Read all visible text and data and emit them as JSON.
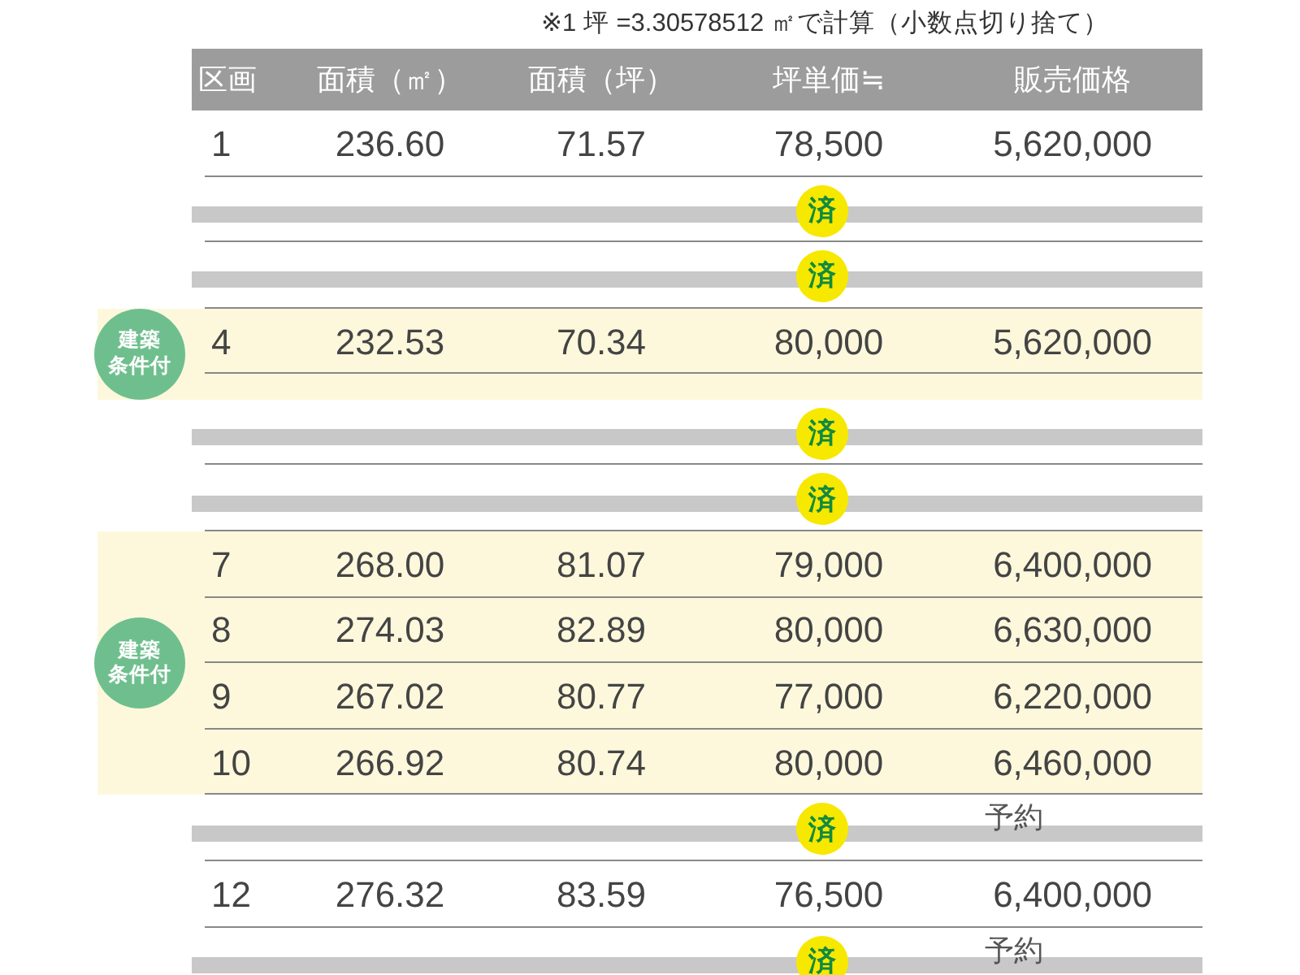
{
  "note": "※1 坪 =3.30578512 ㎡で計算（小数点切り捨て）",
  "table": {
    "columns": [
      "区画",
      "面積（㎡）",
      "面積（坪）",
      "坪単価≒",
      "販売価格"
    ],
    "blocks": [
      {
        "kind": "plain",
        "rows": [
          {
            "kind": "available",
            "cells": [
              "1",
              "236.60",
              "71.57",
              "78,500",
              "5,620,000"
            ]
          },
          {
            "kind": "sold",
            "badge": "済"
          },
          {
            "kind": "sold",
            "badge": "済"
          }
        ]
      },
      {
        "kind": "conditional",
        "badge_lines": [
          "建築",
          "条件付"
        ],
        "rows": [
          {
            "kind": "available",
            "cells": [
              "4",
              "232.53",
              "70.34",
              "80,000",
              "5,620,000"
            ]
          }
        ]
      },
      {
        "kind": "plain",
        "rows": [
          {
            "kind": "sold",
            "badge": "済"
          },
          {
            "kind": "sold",
            "badge": "済"
          }
        ]
      },
      {
        "kind": "conditional",
        "badge_lines": [
          "建築",
          "条件付"
        ],
        "rows": [
          {
            "kind": "available",
            "cells": [
              "7",
              "268.00",
              "81.07",
              "79,000",
              "6,400,000"
            ]
          },
          {
            "kind": "available",
            "cells": [
              "8",
              "274.03",
              "82.89",
              "80,000",
              "6,630,000"
            ]
          },
          {
            "kind": "available",
            "cells": [
              "9",
              "267.02",
              "80.77",
              "77,000",
              "6,220,000"
            ]
          },
          {
            "kind": "available",
            "cells": [
              "10",
              "266.92",
              "80.74",
              "80,000",
              "6,460,000"
            ]
          }
        ]
      },
      {
        "kind": "plain",
        "rows": [
          {
            "kind": "sold",
            "badge": "済",
            "note": "予約"
          },
          {
            "kind": "available",
            "cells": [
              "12",
              "276.32",
              "83.59",
              "76,500",
              "6,400,000"
            ]
          },
          {
            "kind": "sold",
            "badge": "済",
            "note": "予約"
          }
        ]
      }
    ]
  }
}
